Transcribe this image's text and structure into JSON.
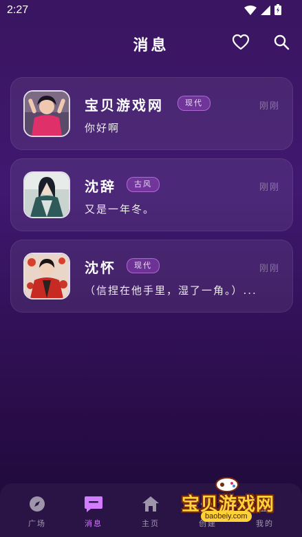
{
  "status": {
    "time": "2:27"
  },
  "header": {
    "title": "消息"
  },
  "conversations": [
    {
      "name": "宝贝游戏网",
      "tag": "现代",
      "time": "刚刚",
      "preview": "你好啊"
    },
    {
      "name": "沈辞",
      "tag": "古风",
      "time": "刚刚",
      "preview": "又是一年冬。"
    },
    {
      "name": "沈怀",
      "tag": "现代",
      "time": "刚刚",
      "preview": "（信捏在他手里，湿了一角。）..."
    }
  ],
  "tabbar": {
    "items": [
      {
        "label": "广场"
      },
      {
        "label": "消息"
      },
      {
        "label": "主页"
      },
      {
        "label": "创建"
      },
      {
        "label": "我的"
      }
    ]
  },
  "watermark": {
    "text": "宝贝游戏网",
    "url": "baobeiy.com"
  },
  "colors": {
    "accent": "#d27cff",
    "tag_bg": "#7a3aa0",
    "background": "#3a1560"
  }
}
